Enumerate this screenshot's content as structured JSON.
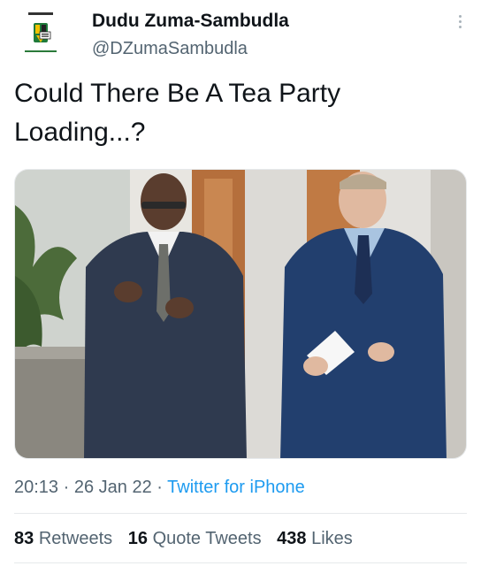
{
  "user": {
    "display_name": "Dudu Zuma-Sambudla",
    "handle": "@DZumaSambudla"
  },
  "tweet": {
    "text_line1": "Could There Be A Tea Party",
    "text_line2": "Loading...?"
  },
  "meta": {
    "time": "20:13",
    "separator": "·",
    "date": "26 Jan 22",
    "source": "Twitter for iPhone"
  },
  "stats": {
    "retweets_count": "83",
    "retweets_label": "Retweets",
    "quotes_count": "16",
    "quotes_label": "Quote Tweets",
    "likes_count": "438",
    "likes_label": "Likes"
  },
  "icons": {
    "more": "more-vertical-icon"
  },
  "colors": {
    "link": "#1d9bf0",
    "secondary_text": "#536471",
    "primary_text": "#0f1419",
    "divider": "#e6e9eb"
  }
}
